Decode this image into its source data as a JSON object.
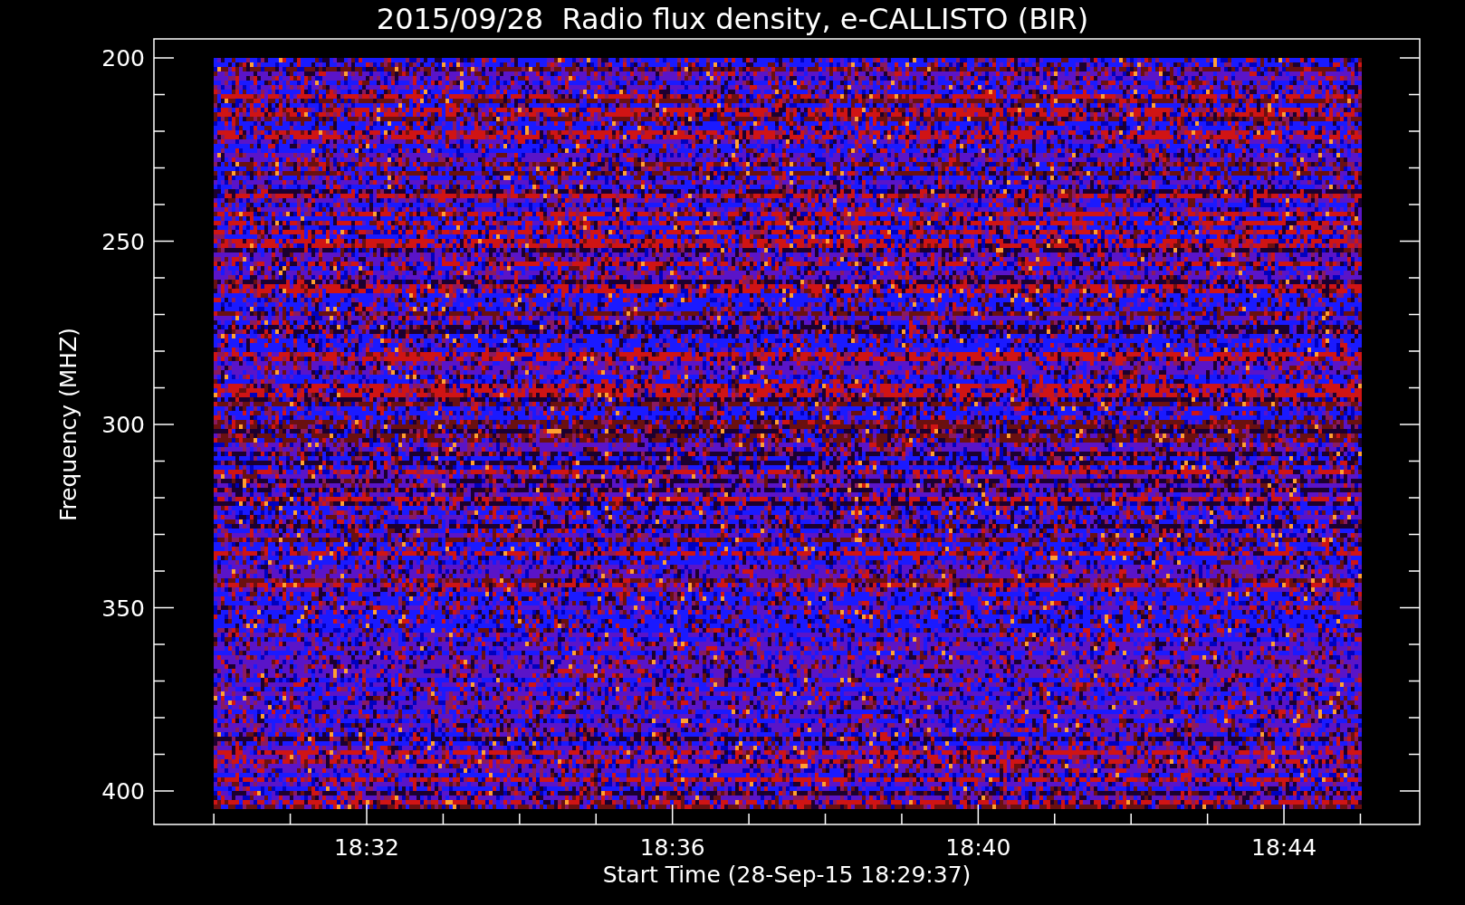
{
  "title": "2015/09/28  Radio flux density, e-CALLISTO (BIR)",
  "y_axis": {
    "label": "Frequency (MHZ)",
    "ticks": [
      "200",
      "250",
      "300",
      "350",
      "400"
    ]
  },
  "x_axis": {
    "label": "Start Time (28-Sep-15 18:29:37)",
    "ticks": [
      "18:32",
      "18:36",
      "18:40",
      "18:44"
    ]
  }
}
